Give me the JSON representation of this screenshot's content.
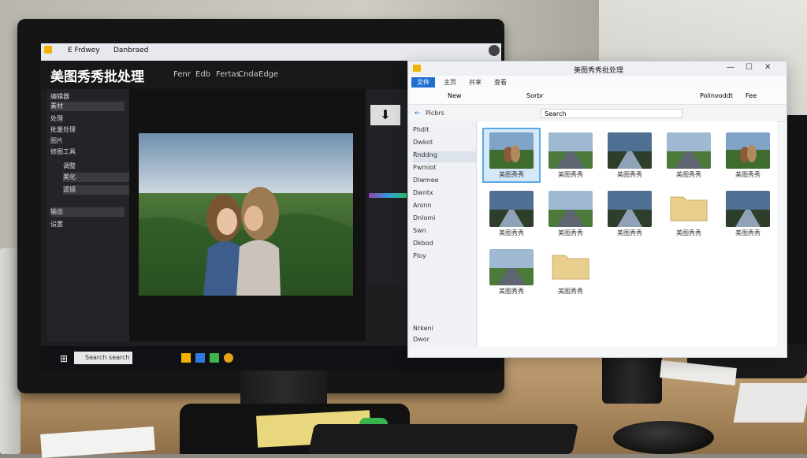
{
  "left_app": {
    "window_tabs": [
      "E Frdwey",
      "Danbraed"
    ],
    "title": "美图秀秀批处理",
    "menu": [
      "Fenr",
      "Edb",
      "Fertas",
      "Cnda",
      "Edge"
    ],
    "sidebar_items": [
      "编辑器",
      "素材",
      "处理",
      "批量处理",
      "图片",
      "修图工具",
      "调整",
      "美化",
      "滤镜",
      "输出",
      "设置"
    ],
    "search_placeholder": "Search search"
  },
  "explorer": {
    "title": "美图秀秀批处理",
    "ribbon_tabs": [
      "文件",
      "主页",
      "共享",
      "查看"
    ],
    "toolbar": [
      "New",
      "Sorbr",
      "Polinvoddt",
      "Fee"
    ],
    "address_path": "Picbrs",
    "address_search": "Search",
    "nav_items": [
      "Phdit",
      "Dwkot",
      "Rnddng",
      "Pwmiot",
      "Diwmee",
      "Dwntx",
      "Aronn",
      "Dnlomi",
      "Swn",
      "Dkbod",
      "Ploy",
      "Nrkeni",
      "Dwor"
    ],
    "items": [
      {
        "kind": "photo",
        "label": "美图秀秀",
        "scene": "couple"
      },
      {
        "kind": "photo",
        "label": "美图秀秀",
        "scene": "road"
      },
      {
        "kind": "photo",
        "label": "美图秀秀",
        "scene": "road-dark"
      },
      {
        "kind": "photo",
        "label": "美图秀秀",
        "scene": "road"
      },
      {
        "kind": "photo",
        "label": "美图秀秀",
        "scene": "couple"
      },
      {
        "kind": "photo",
        "label": "美图秀秀",
        "scene": "road-dark"
      },
      {
        "kind": "photo",
        "label": "美图秀秀",
        "scene": "road"
      },
      {
        "kind": "photo",
        "label": "美图秀秀",
        "scene": "road-dark"
      },
      {
        "kind": "folder",
        "label": "美图秀秀"
      },
      {
        "kind": "photo",
        "label": "美图秀秀",
        "scene": "road-dark"
      },
      {
        "kind": "photo",
        "label": "美图秀秀",
        "scene": "road"
      },
      {
        "kind": "folder",
        "label": "美图秀秀"
      }
    ]
  },
  "colors": {
    "selection": "#5aa9e6",
    "ribbon_active": "#1f6fd1",
    "folder": "#e8cf8d"
  }
}
